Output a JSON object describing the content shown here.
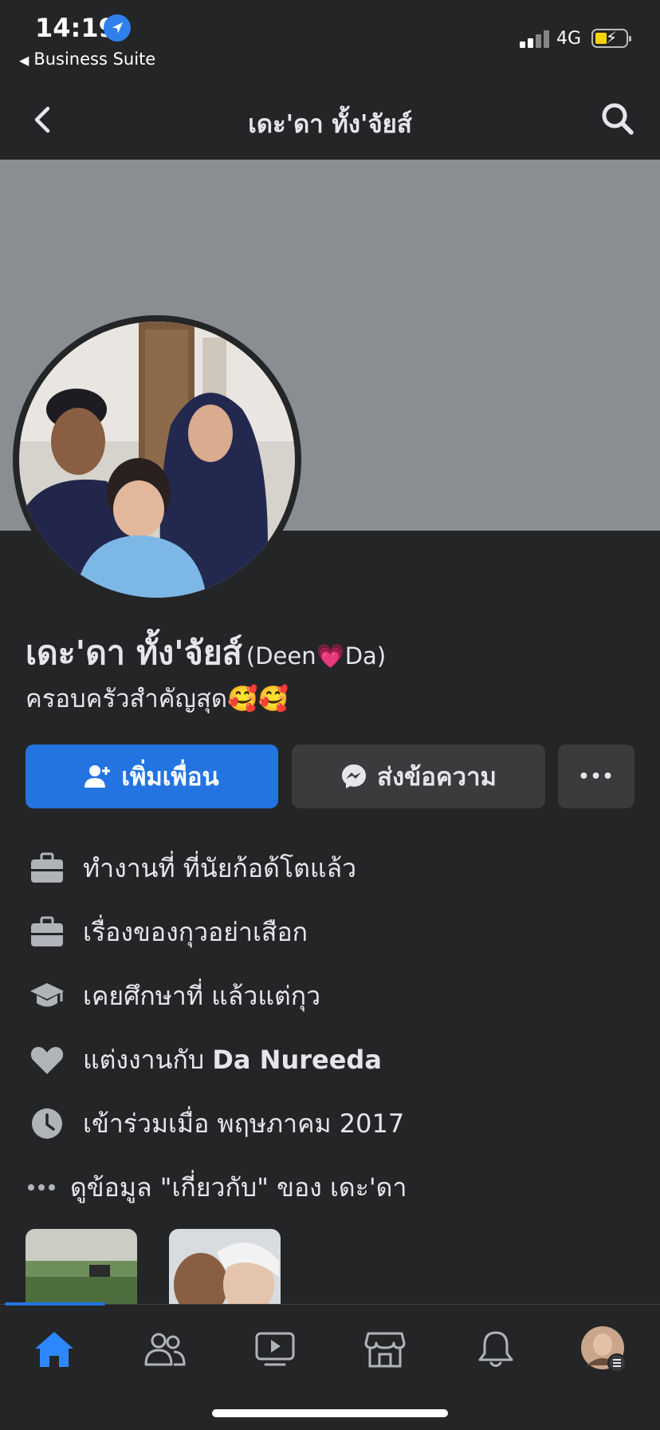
{
  "status_bar": {
    "time": "14:19",
    "back_app": "Business Suite",
    "network": "4G"
  },
  "header": {
    "title": "เดะ'ดา ทั้ง'จัยส์"
  },
  "profile": {
    "name": "เดะ'ดา ทั้ง'จัยส์",
    "alt_name": "(Deen💗Da)",
    "bio": "ครอบครัวสำคัญสุด🥰🥰"
  },
  "actions": {
    "add_friend": "เพิ่มเพื่อน",
    "message": "ส่งข้อความ",
    "more": "•••"
  },
  "details": [
    {
      "icon": "briefcase-icon",
      "text": "ทำงานที่ ที่นัยก้อด้โตแล้ว"
    },
    {
      "icon": "briefcase-icon",
      "text": "เรื่องของกุวอย่าเสือก"
    },
    {
      "icon": "graduation-cap-icon",
      "text": "เคยศึกษาที่ แล้วแต่กุว"
    },
    {
      "icon": "heart-icon",
      "prefix": "แต่งงานกับ",
      "bold": "Da Nureeda"
    },
    {
      "icon": "clock-icon",
      "text": "เข้าร่วมเมื่อ พฤษภาคม  2017"
    },
    {
      "icon": "more-dots-icon",
      "text": "ดูข้อมูล \"เกี่ยวกับ\" ของ เดะ'ดา"
    }
  ],
  "tabs": [
    {
      "icon": "home-icon",
      "active": true
    },
    {
      "icon": "friends-icon",
      "active": false
    },
    {
      "icon": "video-icon",
      "active": false
    },
    {
      "icon": "marketplace-icon",
      "active": false
    },
    {
      "icon": "bell-icon",
      "active": false
    },
    {
      "icon": "menu-avatar-icon",
      "active": false
    }
  ],
  "colors": {
    "background": "#242526",
    "accent": "#2374e1",
    "cover": "#8a8d91",
    "button_secondary": "#3a3b3c"
  }
}
